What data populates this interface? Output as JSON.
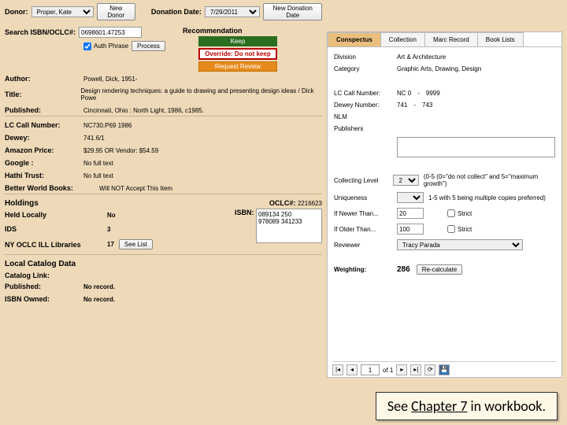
{
  "header": {
    "donor_label": "Donor:",
    "donor_value": "Proper, Kate",
    "new_donor": "New Donor",
    "donation_date_label": "Donation Date:",
    "donation_date_value": "7/29/2011",
    "new_date": "New Donation Date"
  },
  "search": {
    "label": "Search ISBN/OCLC#:",
    "value": "0698601.47253",
    "auth_phrase": "Auth Phrase",
    "process": "Process"
  },
  "rec": {
    "title": "Recommendation",
    "keep": "Keep",
    "override": "Override:  Do not keep",
    "review": "Request Review"
  },
  "biblio": {
    "author_label": "Author:",
    "author_value": "Powell, Dick, 1951-",
    "title_label": "Title:",
    "title_value": "Design rendering techniques: a guide to drawing and presenting design ideas / Dick Powe",
    "published_label": "Published:",
    "published_value": "Cincinnati, Ohio : North Light, 1986, c1985.",
    "lc_label": "LC Call Number:",
    "lc_value": "NC730.P69 1986",
    "dewey_label": "Dewey:",
    "dewey_value": "741.6/1",
    "amazon_label": "Amazon Price:",
    "amazon_value": "$29.95 OR Vendor: $54.59",
    "google_label": "Google :",
    "google_value": "No full text",
    "hathi_label": "Hathi Trust:",
    "hathi_value": "No full text",
    "bwb_label": "Better World Books:",
    "bwb_value": "Will NOT Accept This Item"
  },
  "holdings": {
    "title": "Holdings",
    "oclc_label": "OCLC#:",
    "oclc_value": "2216623",
    "isbn_label": "ISBN:",
    "isbn_values": "089134 250\n978089 341233",
    "local_label": "Held Locally",
    "local_value": "No",
    "ids_label": "IDS",
    "ids_value": "3",
    "nyoclc_label": "NY OCLC ILL Libraries",
    "nyoclc_value": "17",
    "see_list": "See List"
  },
  "localcat": {
    "title": "Local Catalog Data",
    "link_label": "Catalog Link:",
    "pub_label": "Published:",
    "pub_value": "No record.",
    "owned_label": "ISBN Owned:",
    "owned_value": "No record."
  },
  "tabs": {
    "conspectus": "Conspectus",
    "collection": "Collection",
    "marc": "Marc Record",
    "booklists": "Book Lists"
  },
  "conspectus": {
    "division_label": "Division",
    "division_value": "Art & Architecture",
    "category_label": "Category",
    "category_value": "Graphic Arts, Drawing, Design",
    "lc_label": "LC Call Number:",
    "lc_from": "NC   0",
    "lc_to": "9999",
    "dewey_label": "Dewey Number:",
    "dewey_from": "741",
    "dewey_to": "743",
    "nlm_label": "NLM",
    "publishers_label": "Publishers",
    "collecting_label": "Collecting Level",
    "collecting_value": "2",
    "collecting_hint": "(0-5 (0=\"do not collect\" and 5=\"maximum growth\")",
    "uniqueness_label": "Uniqueness",
    "uniqueness_hint": "1-5 with 5 being multiple copies preferred)",
    "newer_label": "If Newer Than...",
    "newer_value": "20",
    "older_label": "If Older Than...",
    "older_value": "100",
    "strict": "Strict",
    "reviewer_label": "Reviewer",
    "reviewer_value": "Tracy Parada",
    "weighting_label": "Weighting:",
    "weighting_value": "286",
    "recalc": "Re-calculate",
    "page_of": "of 1",
    "page_cur": "1"
  },
  "chapter": {
    "pre": "See ",
    "mid": "Chapter 7",
    "post": " in workbook."
  }
}
